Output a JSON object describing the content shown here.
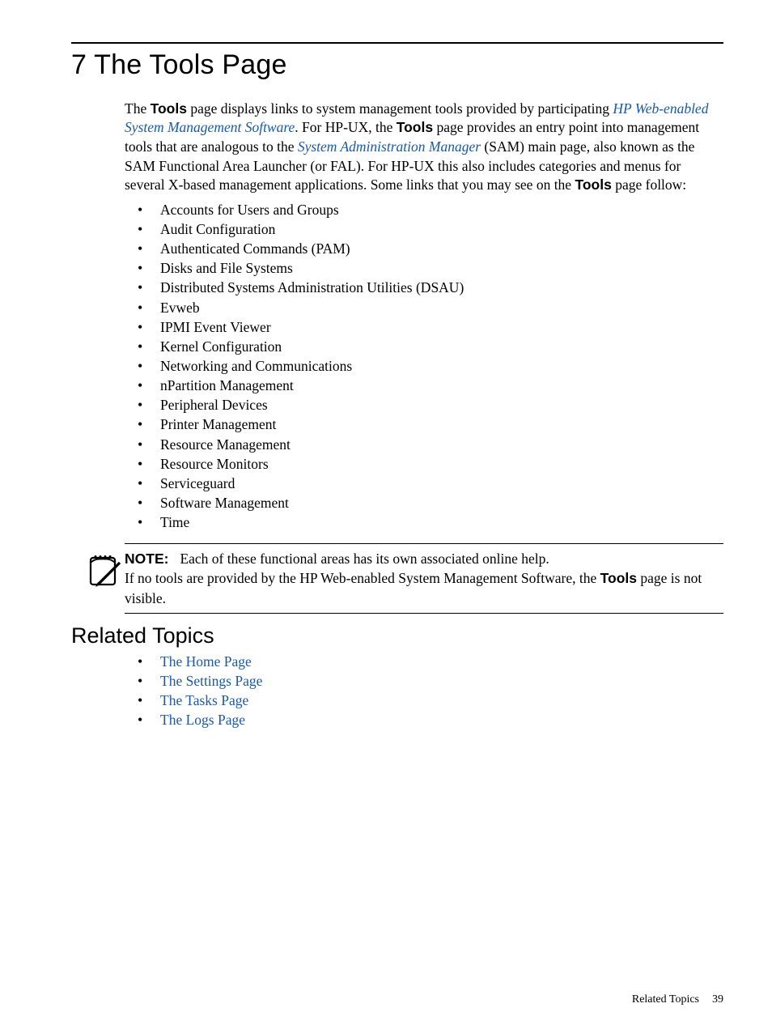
{
  "chapter": {
    "title": "7 The Tools Page"
  },
  "intro": {
    "part1": "The ",
    "bold1": "Tools",
    "part2": " page displays links to system management tools provided by participating ",
    "link1": "HP Web-enabled System Management Software",
    "part3": ". For HP-UX, the ",
    "bold2": "Tools",
    "part4": " page provides an entry point into management tools that are analogous to the ",
    "link2": "System Administration Manager",
    "part5": " (SAM) main page, also known as the SAM Functional Area Launcher (or FAL). For HP-UX this also includes categories and menus for several X-based management applications. Some links that you may see on the ",
    "bold3": "Tools",
    "part6": " page follow:"
  },
  "tools_list": [
    "Accounts for Users and Groups",
    "Audit Configuration",
    "Authenticated Commands (PAM)",
    "Disks and File Systems",
    "Distributed Systems Administration Utilities (DSAU)",
    "Evweb",
    "IPMI Event Viewer",
    "Kernel Configuration",
    "Networking and Communications",
    "nPartition Management",
    "Peripheral Devices",
    "Printer Management",
    "Resource Management",
    "Resource Monitors",
    "Serviceguard",
    "Software Management",
    "Time"
  ],
  "note": {
    "label": "NOTE:",
    "line1": "Each of these functional areas has its own associated online help.",
    "line2a": "If no tools are provided by the HP Web-enabled System Management Software, the ",
    "line2bold": "Tools",
    "line2b": " page is not visible."
  },
  "related": {
    "title": "Related Topics",
    "links": [
      "The Home Page",
      "The Settings Page",
      "The Tasks Page",
      "The Logs Page"
    ]
  },
  "footer": {
    "label": "Related Topics",
    "page": "39"
  }
}
